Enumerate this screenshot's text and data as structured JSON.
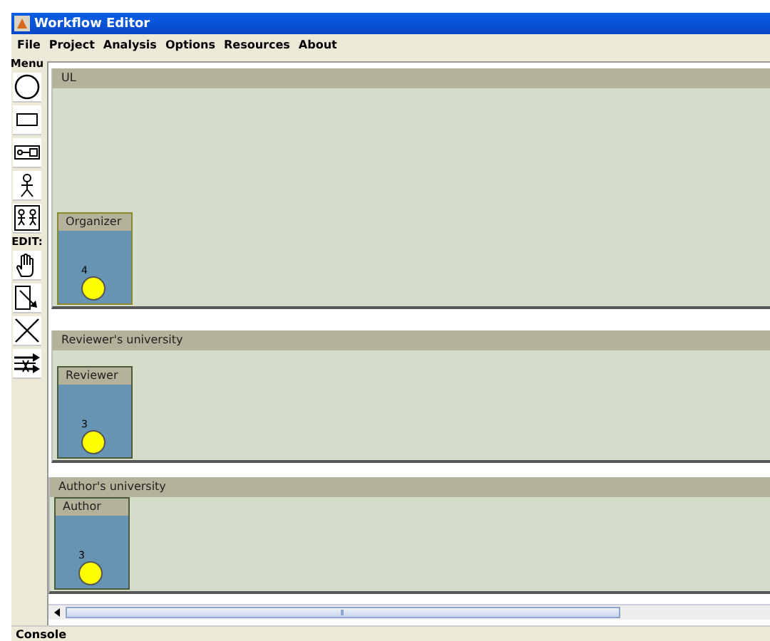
{
  "window": {
    "title": "Workflow Editor"
  },
  "menu": [
    "File",
    "Project",
    "Analysis",
    "Options",
    "Resources",
    "About"
  ],
  "toolbar": {
    "label": "Menu",
    "edit_label": "EDIT:",
    "draw_tools": [
      {
        "kind": "circle"
      },
      {
        "kind": "rectangle"
      },
      {
        "kind": "connector"
      },
      {
        "kind": "actor"
      },
      {
        "kind": "actors"
      }
    ],
    "edit_tools": [
      {
        "kind": "hand"
      },
      {
        "kind": "resize"
      },
      {
        "kind": "delete"
      },
      {
        "kind": "arrows"
      }
    ]
  },
  "lanes": [
    {
      "title": "UL",
      "roles": [
        {
          "name": "Organizer",
          "count": "4"
        }
      ]
    },
    {
      "title": "Reviewer's university",
      "roles": [
        {
          "name": "Reviewer",
          "count": "3"
        }
      ]
    },
    {
      "title": "Author's university",
      "roles": [
        {
          "name": "Author",
          "count": "3"
        }
      ]
    }
  ],
  "console": {
    "label": "Console"
  }
}
